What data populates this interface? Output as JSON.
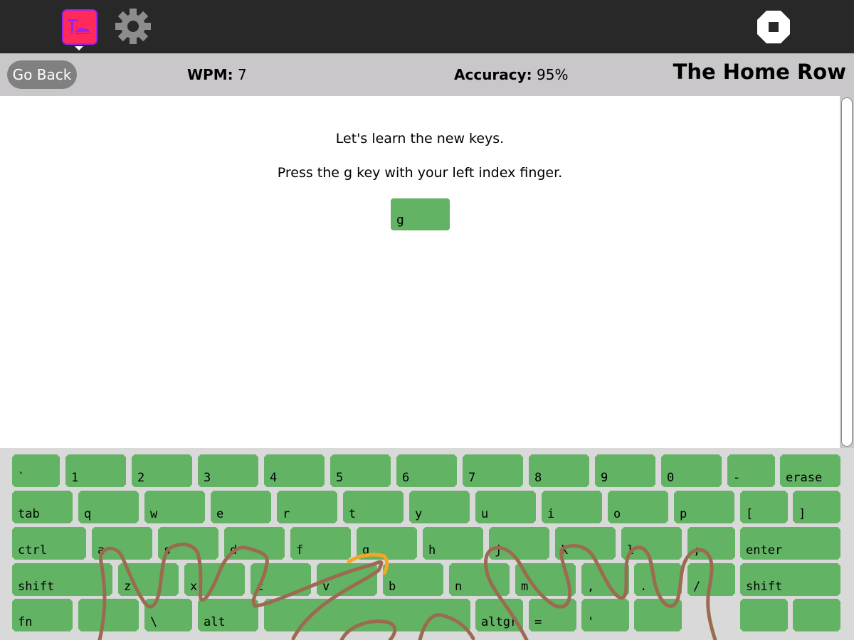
{
  "toolbar": {
    "activity_icon": "typing-turtle-icon",
    "settings_icon": "gear-icon",
    "stop_icon": "stop-icon"
  },
  "status": {
    "go_back": "Go Back",
    "wpm_label": "WPM:",
    "wpm_value": "7",
    "accuracy_label": "Accuracy:",
    "accuracy_value": "95%",
    "lesson_title": "The Home Row"
  },
  "lesson": {
    "line1": "Let's learn the new keys.",
    "line2": "Press the g key with your left index finger.",
    "target_key": "g"
  },
  "keyboard": {
    "rows": [
      [
        "`",
        "1",
        "2",
        "3",
        "4",
        "5",
        "6",
        "7",
        "8",
        "9",
        "0",
        "-",
        "erase"
      ],
      [
        "tab",
        "q",
        "w",
        "e",
        "r",
        "t",
        "y",
        "u",
        "i",
        "o",
        "p",
        "[",
        "]"
      ],
      [
        "ctrl",
        "a",
        "s",
        "d",
        "f",
        "g",
        "h",
        "j",
        "k",
        "l",
        ";",
        "enter"
      ],
      [
        "shift",
        "z",
        "x",
        "c",
        "v",
        "b",
        "n",
        "m",
        ",",
        ".",
        "/",
        "shift"
      ],
      [
        "fn",
        "",
        "\\",
        "alt",
        "",
        "altgr",
        "=",
        "'",
        "",
        "",
        ""
      ]
    ],
    "highlight_key": "g",
    "key_color": "#63b365",
    "finger_color": "#9b6b50",
    "highlight_finger_color": "#f5a623"
  },
  "colors": {
    "toolbar_bg": "#282828",
    "statusbar_bg": "#c9c7ca",
    "go_back_bg": "#808080"
  }
}
